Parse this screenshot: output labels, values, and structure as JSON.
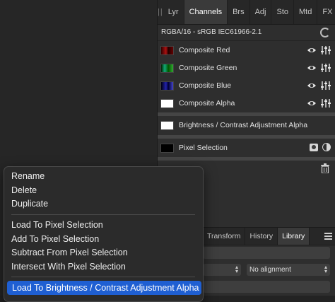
{
  "tabs": [
    "Lyr",
    "Channels",
    "Brs",
    "Adj",
    "Sto",
    "Mtd",
    "FX"
  ],
  "active_tab": "Channels",
  "color_info": "RGBA/16 - sRGB IEC61966-2.1",
  "channels": [
    {
      "label": "Composite Red",
      "thumb": "red"
    },
    {
      "label": "Composite Green",
      "thumb": "green"
    },
    {
      "label": "Composite Blue",
      "thumb": "blue"
    },
    {
      "label": "Composite Alpha",
      "thumb": "white"
    }
  ],
  "adjustment_channel": {
    "label": "Brightness / Contrast Adjustment Alpha"
  },
  "pixel_selection": {
    "label": "Pixel Selection"
  },
  "lower_tabs": [
    "Transform",
    "History",
    "Library"
  ],
  "active_lower_tab": "Library",
  "alignment_value": "No alignment",
  "menu": {
    "group1": [
      "Rename",
      "Delete",
      "Duplicate"
    ],
    "group2": [
      "Load To Pixel Selection",
      "Add To Pixel Selection",
      "Subtract From Pixel Selection",
      "Intersect With Pixel Selection"
    ],
    "highlighted": "Load To Brightness / Contrast Adjustment Alpha"
  },
  "colors": {
    "highlight": "#1f5fd2",
    "panel": "#2e2e2e"
  }
}
